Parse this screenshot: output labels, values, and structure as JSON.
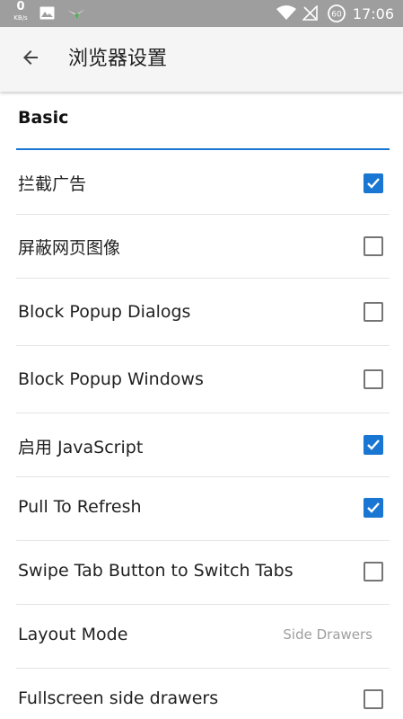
{
  "status_bar": {
    "net_speed_value": "0",
    "net_speed_unit": "KB/s",
    "time": "17:06",
    "battery_label": "60",
    "icons": [
      "image-icon",
      "cat-app-icon",
      "wifi-icon",
      "no-signal-icon",
      "battery-icon"
    ]
  },
  "toolbar": {
    "title": "浏览器设置",
    "back_icon": "arrow-back-icon"
  },
  "section": {
    "header": "Basic",
    "accent_color": "#1976d2"
  },
  "settings": [
    {
      "label": "拦截广告",
      "checked": true
    },
    {
      "label": "屏蔽网页图像",
      "checked": false
    },
    {
      "label": "Block Popup Dialogs",
      "checked": false
    },
    {
      "label": "Block Popup Windows",
      "checked": false
    },
    {
      "label": "启用 JavaScript",
      "checked": true
    },
    {
      "label": "Pull To Refresh",
      "checked": true
    },
    {
      "label": "Swipe Tab Button to Switch Tabs",
      "checked": false
    },
    {
      "label": "Layout Mode",
      "value": "Side Drawers"
    },
    {
      "label": "Fullscreen side drawers",
      "checked": false
    }
  ]
}
